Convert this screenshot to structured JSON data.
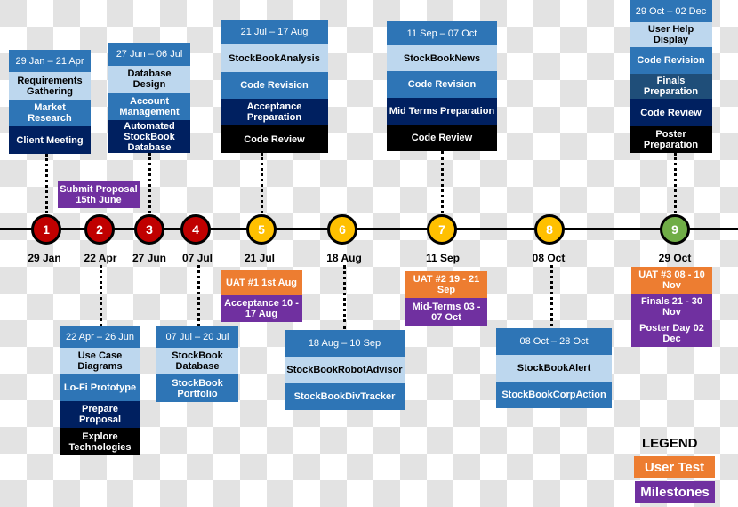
{
  "colors": {
    "date_header": "#2e75b6",
    "light": "#bdd7ee",
    "mid": "#2e75b6",
    "navy": "#1f4e79",
    "dark": "#002060",
    "black": "#000000",
    "user_test": "#ed7d31",
    "milestone": "#7030a0",
    "phase1": "#c00000",
    "phase2": "#ffc000",
    "phase3": "#70ad47"
  },
  "timeline": [
    {
      "num": "1",
      "date": "29 Jan",
      "color": "red"
    },
    {
      "num": "2",
      "date": "22 Apr",
      "color": "red"
    },
    {
      "num": "3",
      "date": "27 Jun",
      "color": "red"
    },
    {
      "num": "4",
      "date": "07 Jul",
      "color": "red"
    },
    {
      "num": "5",
      "date": "21 Jul",
      "color": "yellow"
    },
    {
      "num": "6",
      "date": "18 Aug",
      "color": "yellow"
    },
    {
      "num": "7",
      "date": "11 Sep",
      "color": "yellow"
    },
    {
      "num": "8",
      "date": "08 Oct",
      "color": "yellow"
    },
    {
      "num": "9",
      "date": "29 Oct",
      "color": "green"
    }
  ],
  "boxes": [
    {
      "rows": [
        {
          "t": "29 Jan – 21 Apr",
          "s": "date"
        },
        {
          "t": "Requirements Gathering",
          "s": "light"
        },
        {
          "t": "Market Research",
          "s": "mid"
        },
        {
          "t": "Client Meeting",
          "s": "dark"
        }
      ]
    },
    {
      "rows": [
        {
          "t": "27 Jun – 06 Jul",
          "s": "date"
        },
        {
          "t": "Database Design",
          "s": "light"
        },
        {
          "t": "Account Management",
          "s": "mid"
        },
        {
          "t": "Automated StockBook Database",
          "s": "dark"
        }
      ]
    },
    {
      "rows": [
        {
          "t": "21 Jul – 17 Aug",
          "s": "date"
        },
        {
          "t": "StockBookAnalysis",
          "s": "light"
        },
        {
          "t": "Code Revision",
          "s": "mid"
        },
        {
          "t": "Acceptance Preparation",
          "s": "dark"
        },
        {
          "t": "Code Review",
          "s": "black"
        }
      ]
    },
    {
      "rows": [
        {
          "t": "11 Sep – 07 Oct",
          "s": "date"
        },
        {
          "t": "StockBookNews",
          "s": "light"
        },
        {
          "t": "Code Revision",
          "s": "mid"
        },
        {
          "t": "Mid Terms Preparation",
          "s": "dark"
        },
        {
          "t": "Code Review",
          "s": "black"
        }
      ]
    },
    {
      "rows": [
        {
          "t": "29 Oct – 02 Dec",
          "s": "date"
        },
        {
          "t": "User Help Display",
          "s": "light"
        },
        {
          "t": "Code Revision",
          "s": "mid"
        },
        {
          "t": "Finals Preparation",
          "s": "navy"
        },
        {
          "t": "Code Review",
          "s": "dark"
        },
        {
          "t": "Poster Preparation",
          "s": "black"
        }
      ]
    },
    {
      "rows": [
        {
          "t": "Submit Proposal 15th June",
          "s": "purple"
        }
      ]
    },
    {
      "rows": [
        {
          "t": "22 Apr – 26 Jun",
          "s": "date"
        },
        {
          "t": "Use Case Diagrams",
          "s": "light"
        },
        {
          "t": "Lo-Fi Prototype",
          "s": "mid"
        },
        {
          "t": "Prepare Proposal",
          "s": "dark"
        },
        {
          "t": "Explore Technologies",
          "s": "black"
        }
      ]
    },
    {
      "rows": [
        {
          "t": "07 Jul – 20 Jul",
          "s": "date"
        },
        {
          "t": "StockBook Database",
          "s": "light"
        },
        {
          "t": "StockBook Portfolio",
          "s": "mid"
        }
      ]
    },
    {
      "rows": [
        {
          "t": "UAT #1 1st Aug",
          "s": "orange"
        },
        {
          "t": "Acceptance 10 - 17 Aug",
          "s": "purple"
        }
      ]
    },
    {
      "rows": [
        {
          "t": "18 Aug – 10 Sep",
          "s": "date"
        },
        {
          "t": "StockBookRobotAdvisor",
          "s": "light"
        },
        {
          "t": "StockBookDivTracker",
          "s": "mid"
        }
      ]
    },
    {
      "rows": [
        {
          "t": "UAT #2 19 - 21 Sep",
          "s": "orange"
        },
        {
          "t": "Mid-Terms 03 - 07 Oct",
          "s": "purple"
        }
      ]
    },
    {
      "rows": [
        {
          "t": "08 Oct – 28 Oct",
          "s": "date"
        },
        {
          "t": "StockBookAlert",
          "s": "light"
        },
        {
          "t": "StockBookCorpAction",
          "s": "mid"
        }
      ]
    },
    {
      "rows": [
        {
          "t": "UAT #3 08 - 10 Nov",
          "s": "orange"
        },
        {
          "t": "Finals 21 - 30 Nov",
          "s": "purple"
        },
        {
          "t": "Poster Day 02 Dec",
          "s": "purple"
        }
      ]
    }
  ],
  "legend": {
    "title": "LEGEND",
    "user_test": "User Test",
    "milestones": "Milestones"
  }
}
